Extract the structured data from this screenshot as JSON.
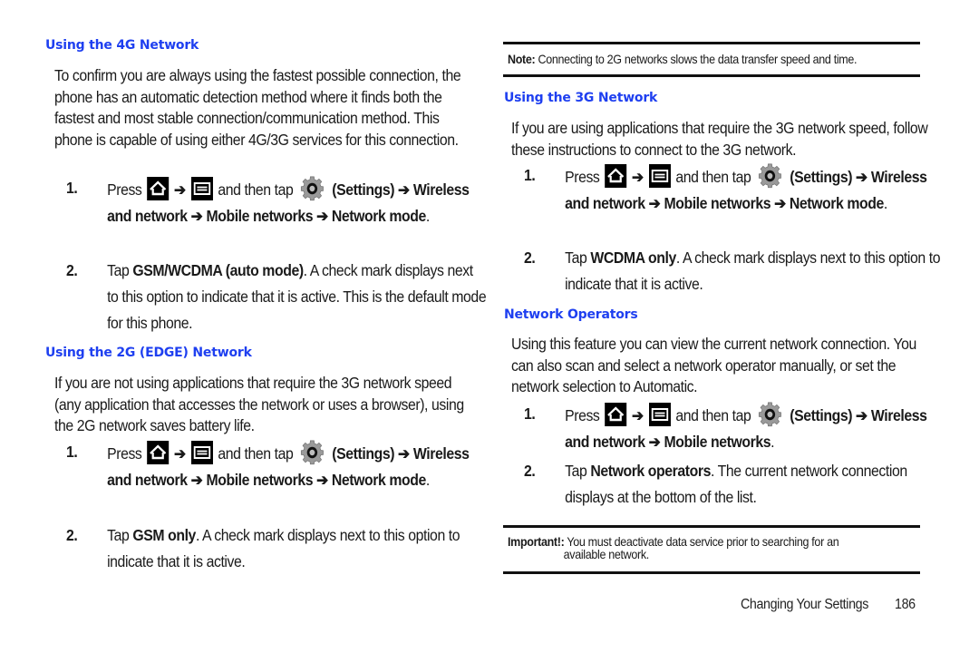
{
  "left": {
    "section_4g": {
      "heading": "Using the 4G Network",
      "paragraph": "To confirm you are always using the fastest possible connection, the phone has an automatic detection method where it finds both the fastest and most stable connection/communication method. This phone is capable of using either 4G/3G services for this connection.",
      "step1": {
        "num": "1.",
        "press": "Press",
        "arrow": "➔",
        "then_tap": "and then tap",
        "settings": "(Settings) ➔",
        "path": "Wireless and network ➔ Mobile networks  ➔ Network mode",
        "end": "."
      },
      "step2": {
        "num": "2.",
        "tap": "Tap",
        "option": "GSM/WCDMA (auto mode)",
        "rest": ". A check mark displays next to this option to indicate that it is active. This is the default mode for this phone."
      }
    },
    "section_2g": {
      "heading": "Using the 2G (EDGE) Network",
      "paragraph": "If you are not using applications that require the 3G network speed (any application that accesses the network or uses a browser), using the 2G network saves battery life.",
      "step1": {
        "num": "1.",
        "press": "Press",
        "arrow": "➔",
        "then_tap": "and then tap",
        "settings": "(Settings) ➔",
        "path": "Wireless and network ➔ Mobile networks  ➔ Network mode",
        "end": "."
      },
      "step2": {
        "num": "2.",
        "tap": "Tap",
        "option": "GSM only",
        "rest": ". A check mark displays next to this option to indicate that it is active."
      }
    }
  },
  "right": {
    "note": {
      "label": "Note:",
      "text": " Connecting to 2G networks slows the data transfer speed and time."
    },
    "section_3g": {
      "heading": "Using the 3G Network",
      "paragraph": "If you are using applications that require the 3G network speed, follow these instructions to connect to the 3G network.",
      "step1": {
        "num": "1.",
        "press": "Press",
        "arrow": "➔",
        "then_tap": "and then tap",
        "settings": "(Settings) ➔",
        "path": "Wireless and network ➔ Mobile networks  ➔ Network mode",
        "end": "."
      },
      "step2": {
        "num": "2.",
        "tap": "Tap",
        "option": "WCDMA only",
        "rest": ". A check mark displays next to this option to indicate that it is active."
      }
    },
    "section_operators": {
      "heading": "Network Operators",
      "paragraph": "Using this feature you can view the current network connection. You can also scan and select a network operator manually, or set the network selection to Automatic.",
      "step1": {
        "num": "1.",
        "press": "Press",
        "arrow": "➔",
        "then_tap": "and then tap",
        "settings": "(Settings) ➔",
        "path": "Wireless and network ➔ Mobile networks",
        "end": "."
      },
      "step2": {
        "num": "2.",
        "tap": "Tap",
        "option": "Network operators",
        "rest": ". The current network connection displays at the bottom of the list."
      }
    },
    "important": {
      "label": "Important!:",
      "line1": " You must deactivate data service prior to searching for an",
      "line2": "available network."
    }
  },
  "footer": {
    "section": "Changing Your Settings",
    "page": "186"
  },
  "icons": {
    "home": "home-icon",
    "menu": "menu-icon",
    "settings": "settings-gear-icon"
  },
  "colors": {
    "heading": "#1e3ff0",
    "text": "#1a1a1a"
  }
}
